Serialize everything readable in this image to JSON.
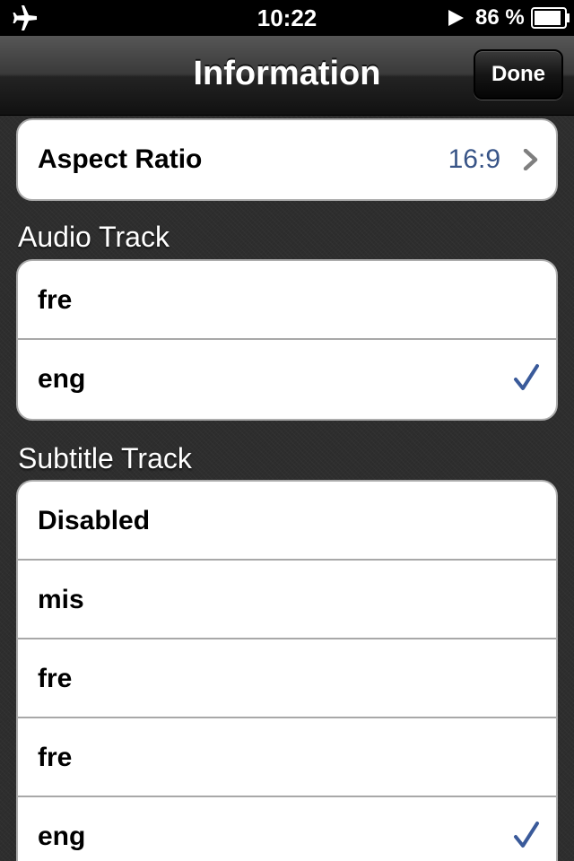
{
  "status_bar": {
    "time": "10:22",
    "battery_percent": "86 %",
    "icons": [
      "airplane-icon",
      "play-icon",
      "battery-icon"
    ]
  },
  "nav": {
    "title": "Information",
    "done_label": "Done"
  },
  "aspect": {
    "label": "Aspect Ratio",
    "value": "16:9"
  },
  "audio": {
    "header": "Audio Track",
    "items": [
      {
        "label": "fre",
        "selected": false
      },
      {
        "label": "eng",
        "selected": true
      }
    ]
  },
  "subtitle": {
    "header": "Subtitle Track",
    "items": [
      {
        "label": "Disabled",
        "selected": false
      },
      {
        "label": "mis",
        "selected": false
      },
      {
        "label": "fre",
        "selected": false
      },
      {
        "label": "fre",
        "selected": false
      },
      {
        "label": "eng",
        "selected": true
      }
    ]
  },
  "colors": {
    "accent": "#385487",
    "checkmark": "#3a5a9a",
    "background": "#2e2e2e"
  }
}
